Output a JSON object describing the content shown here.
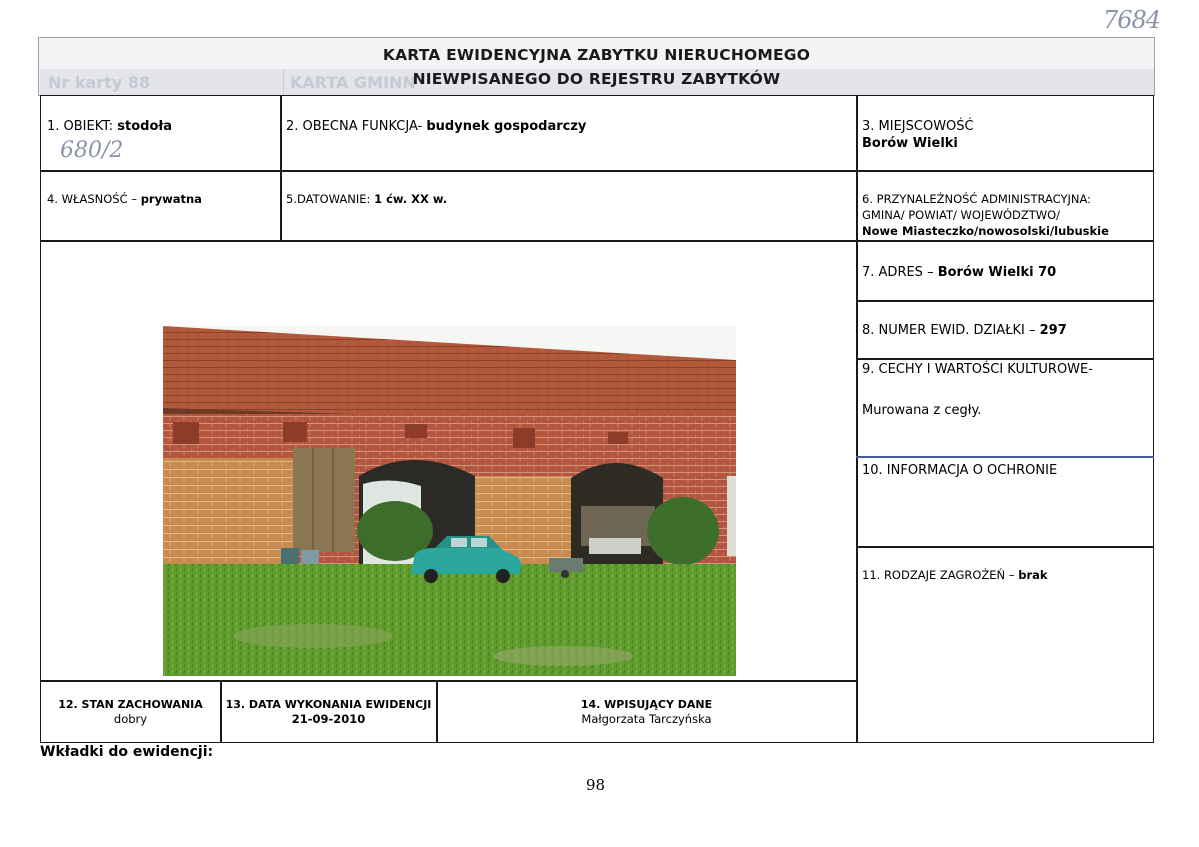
{
  "handwritten": {
    "top_number": "7684",
    "object_annotation": "680/2"
  },
  "title": {
    "line1": "KARTA EWIDENCYJNA ZABYTKU NIERUCHOMEGO",
    "line2": "NIEWPISANEGO DO REJESTRU ZABYTKÓW",
    "ghost_left": "Nr karty 88",
    "ghost_mid": "KARTA GMINN"
  },
  "fields": {
    "f1_label": "1. OBIEKT: ",
    "f1_value": "stodoła",
    "f2_label": "2. OBECNA FUNKCJA- ",
    "f2_value": "budynek gospodarczy",
    "f3_label": "3. MIEJSCOWOŚĆ",
    "f3_value": "Borów Wielki",
    "f4_label": "4. WŁASNOŚĆ – ",
    "f4_value": "prywatna",
    "f5_label": "5.DATOWANIE: ",
    "f5_value": "1 ćw. XX w.",
    "f6_label_1": "6. PRZYNALEŻNOŚĆ ADMINISTRACYJNA:",
    "f6_label_2": "GMINA/ POWIAT/ WOJEWÓDZTWO/",
    "f6_value": "Nowe Miasteczko/nowosolski/lubuskie",
    "f7_label": "7. ADRES – ",
    "f7_value": "Borów Wielki 70",
    "f8_label": "8. NUMER EWID. DZIAŁKI – ",
    "f8_value": "297",
    "f9_label": "9. CECHY  I WARTOŚCI KULTUROWE-",
    "f9_value": "Murowana z cegły.",
    "f10_label": "10. INFORMACJA O OCHRONIE",
    "f11_label": "11. RODZAJE ZAGROŻEŃ – ",
    "f11_value": "brak",
    "f12_label": "12. STAN ZACHOWANIA",
    "f12_value": "dobry",
    "f13_label": "13. DATA WYKONANIA EWIDENCJI",
    "f13_value": "21-09-2010",
    "f14_label": "14. WPISUJĄCY DANE",
    "f14_value": "Małgorzata Tarczyńska"
  },
  "footer": {
    "inserts_label": "Wkładki do ewidencji:",
    "page_number": "98"
  }
}
